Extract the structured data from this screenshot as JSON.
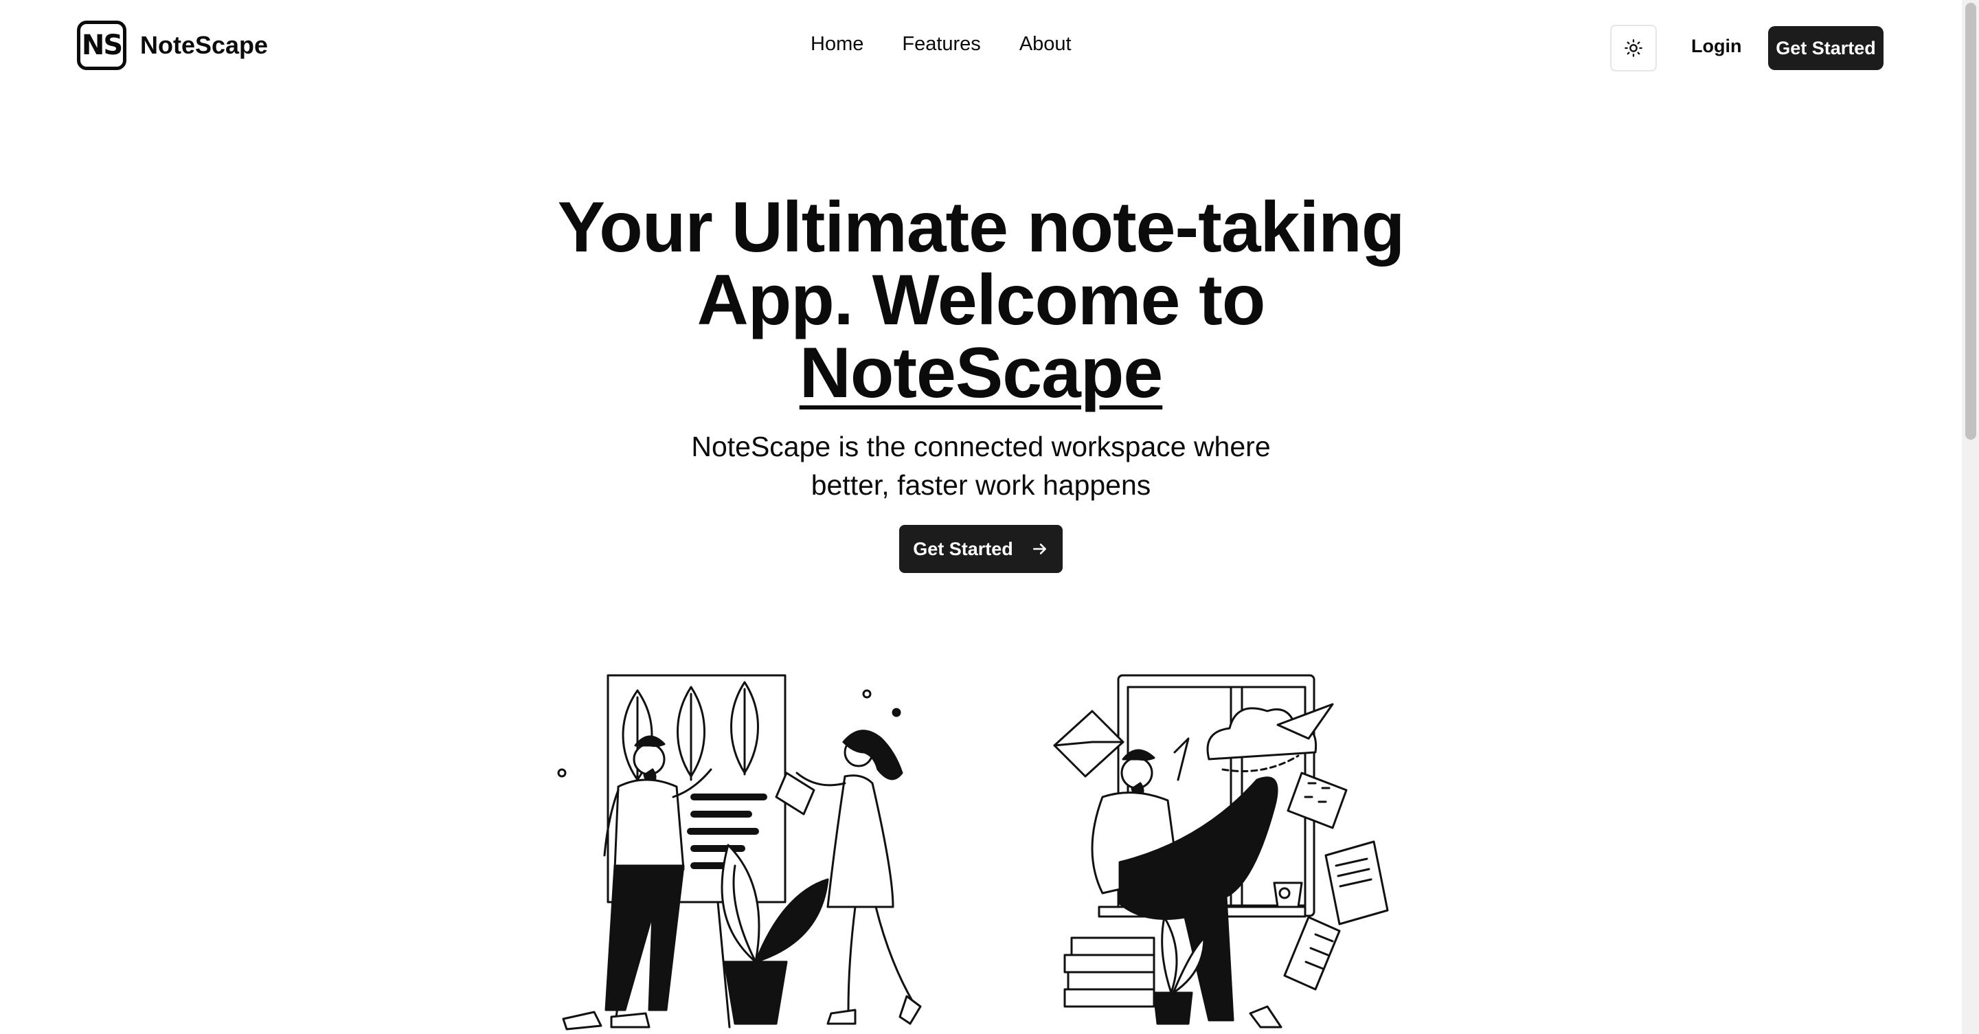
{
  "brand": {
    "mark": "NS",
    "name": "NoteScape"
  },
  "nav": {
    "links": [
      "Home",
      "Features",
      "About"
    ],
    "theme_icon": "sun-icon",
    "login_label": "Login",
    "cta_label": "Get Started"
  },
  "hero": {
    "title_line1": "Your Ultimate note-taking",
    "title_line2": "App. Welcome to",
    "title_brand": "NoteScape",
    "subtitle_line1": "NoteScape is the connected workspace where",
    "subtitle_line2": "better, faster work happens",
    "cta_label": "Get Started",
    "cta_icon": "arrow-right-icon"
  },
  "illustrations": [
    "people-painting-illustration",
    "man-reading-phone-illustration"
  ],
  "colors": {
    "primary": "#1c1c1c",
    "text": "#0b0b0b",
    "background": "#ffffff"
  }
}
